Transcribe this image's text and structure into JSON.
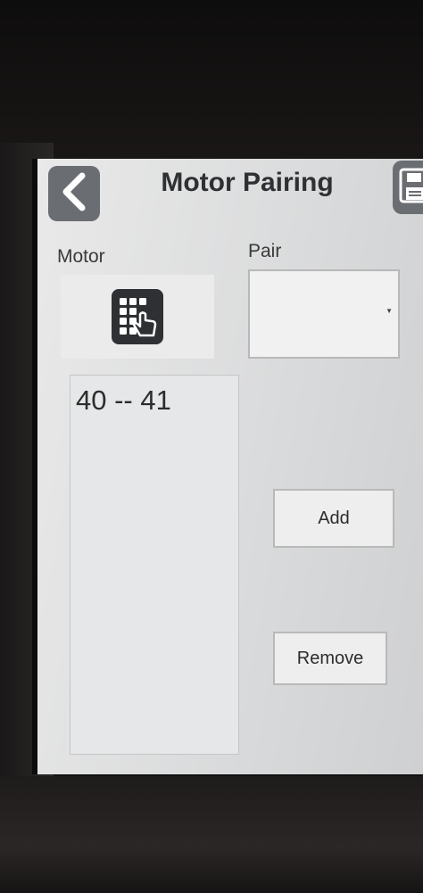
{
  "header": {
    "title": "Motor Pairing",
    "back_icon": "chevron-left-icon",
    "save_icon": "floppy-disk-icon"
  },
  "motor": {
    "label": "Motor",
    "picker_icon": "keypad-touch-icon"
  },
  "pair": {
    "label": "Pair",
    "selected": ""
  },
  "pairs_list": {
    "items": [
      "40 -- 41"
    ]
  },
  "actions": {
    "add_label": "Add",
    "remove_label": "Remove"
  },
  "colors": {
    "screen_bg": "#dcdddf",
    "icon_button_bg": "#6a6d72",
    "title_text": "#2e3033"
  }
}
